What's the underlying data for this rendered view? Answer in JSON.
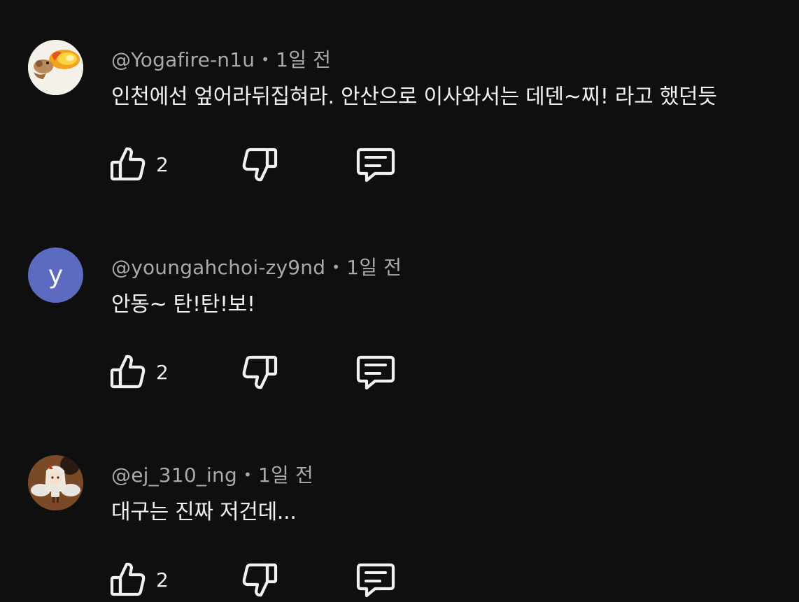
{
  "comments": [
    {
      "avatar": {
        "kind": "image",
        "icon": "fire-dragon-avatar",
        "bg": "#f4f0ea"
      },
      "author": "@Yogafire-n1u",
      "time": "1일 전",
      "text": "인천에선 엎어라뒤집혀라. 안산으로 이사와서는 데덴~찌! 라고 했던듯",
      "likes": "2"
    },
    {
      "avatar": {
        "kind": "letter",
        "letter": "y",
        "bg": "#5c6bc0"
      },
      "author": "@youngahchoi-zy9nd",
      "time": "1일 전",
      "text": "안동~ 탄!탄!보!",
      "likes": "2"
    },
    {
      "avatar": {
        "kind": "image",
        "icon": "angel-figure-avatar",
        "bg": "#7a4a26"
      },
      "author": "@ej_310_ing",
      "time": "1일 전",
      "text": "대구는 진짜 저건데...",
      "likes": "2"
    }
  ],
  "meta_separator": "•",
  "icons": {
    "like": "thumb-up-icon",
    "dislike": "thumb-down-icon",
    "reply": "comment-icon"
  },
  "colors": {
    "background": "#0f0f0f",
    "text": "#f1f1f1",
    "muted": "#aaaaaa"
  }
}
